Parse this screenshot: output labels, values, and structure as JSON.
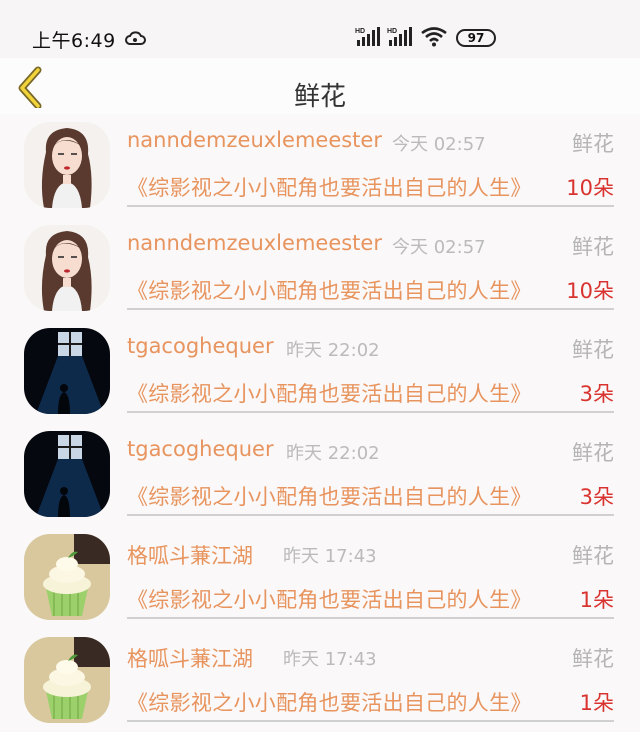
{
  "status": {
    "time": "上午6:49",
    "signal1_label": "HD",
    "signal2_label": "HD",
    "battery": "97"
  },
  "nav": {
    "title": "鲜花"
  },
  "records": [
    {
      "username": "nanndemzeuxlemeester",
      "time": "今天 02:57",
      "type": "鲜花",
      "book": "《综影视之小小配角也要活出自己的人生》",
      "count": "10朵",
      "avatar": "girl"
    },
    {
      "username": "nanndemzeuxlemeester",
      "time": "今天 02:57",
      "type": "鲜花",
      "book": "《综影视之小小配角也要活出自己的人生》",
      "count": "10朵",
      "avatar": "girl"
    },
    {
      "username": "tgacoghequer",
      "time": "昨天 22:02",
      "type": "鲜花",
      "book": "《综影视之小小配角也要活出自己的人生》",
      "count": "3朵",
      "avatar": "window"
    },
    {
      "username": "tgacoghequer",
      "time": "昨天 22:02",
      "type": "鲜花",
      "book": "《综影视之小小配角也要活出自己的人生》",
      "count": "3朵",
      "avatar": "window"
    },
    {
      "username": "格呱斗蒹江湖",
      "time": "昨天 17:43",
      "type": "鲜花",
      "book": "《综影视之小小配角也要活出自己的人生》",
      "count": "1朵",
      "avatar": "cupcake"
    },
    {
      "username": "格呱斗蒹江湖",
      "time": "昨天 17:43",
      "type": "鲜花",
      "book": "《综影视之小小配角也要活出自己的人生》",
      "count": "1朵",
      "avatar": "cupcake"
    }
  ]
}
